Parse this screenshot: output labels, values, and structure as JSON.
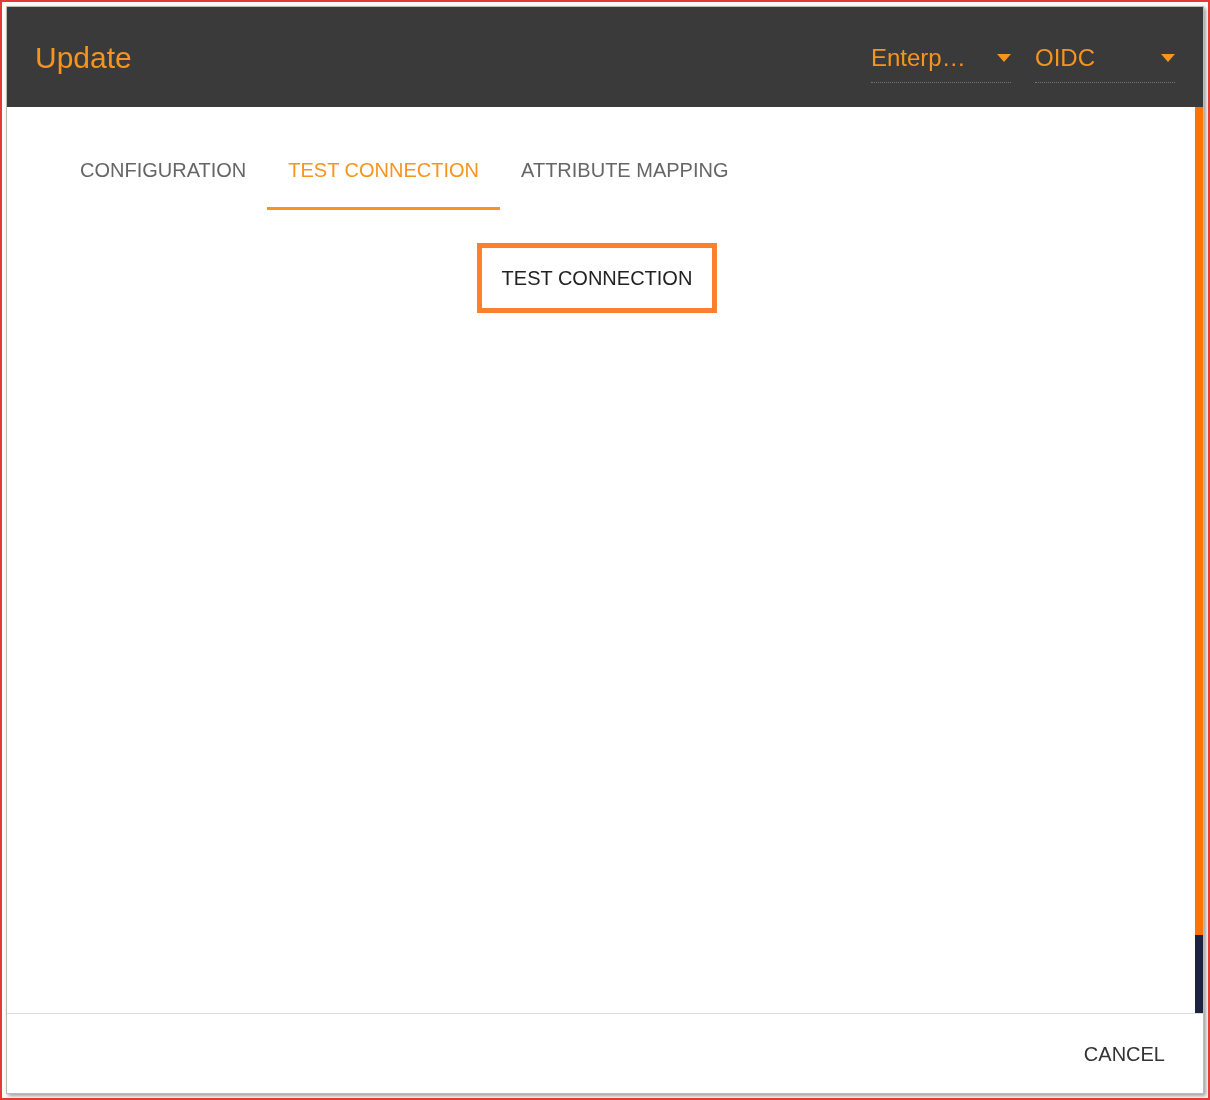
{
  "header": {
    "title": "Update",
    "selects": [
      {
        "value": "Enterp…"
      },
      {
        "value": "OIDC"
      }
    ]
  },
  "tabs": [
    {
      "label": "CONFIGURATION",
      "selected": false
    },
    {
      "label": "TEST CONNECTION",
      "selected": true
    },
    {
      "label": "ATTRIBUTE MAPPING",
      "selected": false
    }
  ],
  "action_button": "TEST CONNECTION",
  "footer": {
    "buttons": [
      "CANCEL"
    ]
  }
}
